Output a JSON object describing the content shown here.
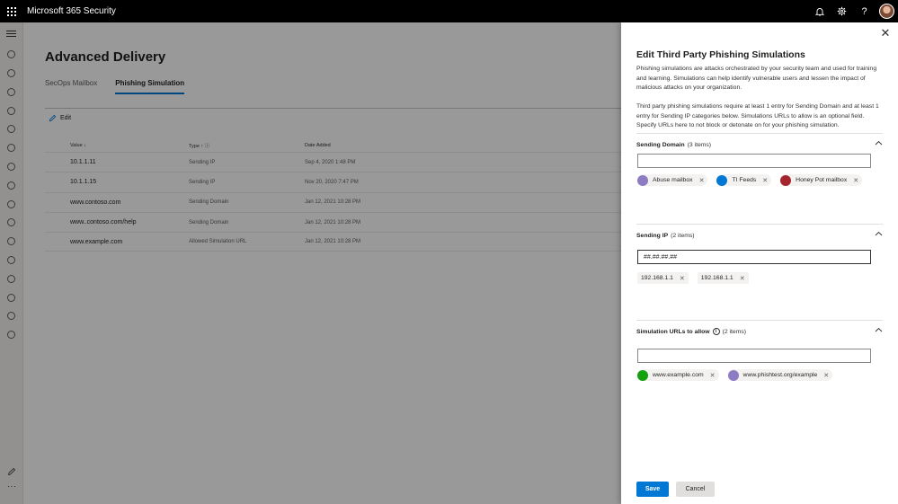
{
  "app": {
    "title": "Microsoft 365 Security"
  },
  "main": {
    "title": "Advanced Delivery",
    "tabs": [
      {
        "label": "SecOps Mailbox",
        "active": false
      },
      {
        "label": "Phishing Simulation",
        "active": true
      }
    ],
    "edit_label": "Edit",
    "table": {
      "headers": {
        "value": "Value ↓",
        "type": "Type",
        "date": "Date Added"
      },
      "rows": [
        {
          "value": "10.1.1.11",
          "type": "Sending IP",
          "date": "Sep 4, 2020 1:48 PM"
        },
        {
          "value": "10.1.1.15",
          "type": "Sending IP",
          "date": "Nov 20, 2020 7:47 PM"
        },
        {
          "value": "www.contoso.com",
          "type": "Sending Domain",
          "date": "Jan 12, 2021 10:28 PM"
        },
        {
          "value": "www..contoso.com/help",
          "type": "Sending Domain",
          "date": "Jan 12, 2021 10:28 PM"
        },
        {
          "value": "www.example.com",
          "type": "Allowed Simulation URL",
          "date": "Jan 12, 2021 10:28 PM"
        }
      ]
    }
  },
  "panel": {
    "title": "Edit Third Party Phishing Simulations",
    "description1": "Phishing simulations are attacks orchestrated by your security team and used for training and learning. Simulations can help identify vulnerable users and lessen the impact of malicious attacks on your organization.",
    "description2": "Third party phishing simulations require at least 1 entry for Sending Domain and at least 1 entry for Sending IP categories below. Simulations URLs to allow is an optional field. Specify URLs here to not block or detonate on for your phishing simulation.",
    "domain": {
      "label": "Sending Domain",
      "count": "(3 items)",
      "value": "",
      "chips": [
        {
          "label": "Abuse mailbox",
          "color": "#8e7cc3"
        },
        {
          "label": "TI Feeds",
          "color": "#0078d4"
        },
        {
          "label": "Honey Pot mailbox",
          "color": "#a4262c"
        }
      ]
    },
    "ip": {
      "label": "Sending IP",
      "count": "(2 items)",
      "value": "##.##.##.##",
      "chips": [
        {
          "label": "192.168.1.1"
        },
        {
          "label": "192.168.1.1"
        }
      ]
    },
    "urls": {
      "label": "Simulation URLs to allow",
      "count": "(2 items)",
      "value": "",
      "chips": [
        {
          "label": "www.example.com",
          "color": "#13a10e"
        },
        {
          "label": "www.phishtest.org/example",
          "color": "#8e7cc3"
        }
      ]
    },
    "save_label": "Save",
    "cancel_label": "Cancel"
  },
  "colors": {
    "accent": "#0078d4",
    "topbar": "#000000"
  }
}
